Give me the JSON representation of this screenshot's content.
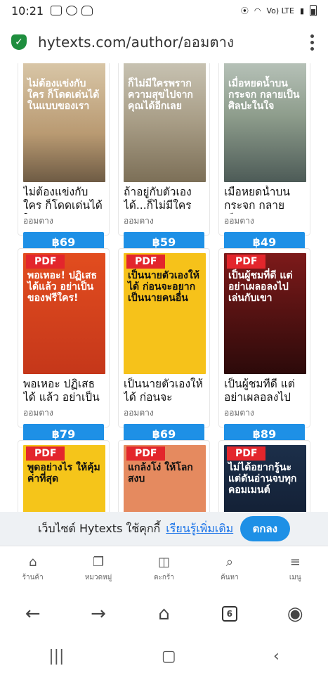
{
  "status": {
    "time": "10:21",
    "net": "Vo) LTE"
  },
  "browser": {
    "url": "hytexts.com/author/ออมตาง"
  },
  "products": [
    {
      "cover_text": "ไม่ต้องแข่งกับใคร ก็โดดเด่นได้ในแบบของเรา",
      "title": "ไม่ต้องแข่งกับใคร ก็โดดเด่นได้ใน...",
      "author": "ออมตาง",
      "price": "฿69",
      "color_class": "c1",
      "badge": ""
    },
    {
      "cover_text": "ก็ไม่มีใครพรากความสุขไปจากคุณได้อีกเลย",
      "title": "ถ้าอยู่กับตัวเอง ได้...ก็ไม่มีใครพรา...",
      "author": "ออมตาง",
      "price": "฿59",
      "color_class": "c2",
      "badge": ""
    },
    {
      "cover_text": "เมื่อหยดน้ำบนกระจก กลายเป็นศิลปะในใจ",
      "title": "เมื่อหยดน้ำบน กระจก กลายเป็น...",
      "author": "ออมตาง",
      "price": "฿49",
      "color_class": "c3",
      "badge": ""
    },
    {
      "cover_text": "พอเหอะ! ปฏิเสธได้แล้ว อย่าเป็นของฟรีใคร!",
      "title": "พอเหอะ ปฏิเสธได้ แล้ว อย่าเป็นขอ...",
      "author": "ออมตาง",
      "price": "฿79",
      "color_class": "c4",
      "badge": "PDF"
    },
    {
      "cover_text": "เป็นนายตัวเองให้ได้ ก่อนจะอยากเป็นนายคนอื่น",
      "title": "เป็นนายตัวเองให้ ได้ ก่อนจะอยาก...",
      "author": "ออมตาง",
      "price": "฿69",
      "color_class": "c5",
      "badge": "PDF"
    },
    {
      "cover_text": "เป็นผู้ชมที่ดี แต่อย่าเผลอลงไปเล่นกับเขา",
      "title": "เป็นผู้ชมที่ดี แต่ อย่าเผลอลงไปเล่...",
      "author": "ออมตาง",
      "price": "฿89",
      "color_class": "c6",
      "badge": "PDF"
    },
    {
      "cover_text": "พูดอย่างไร ให้คุ้มค่าที่สุด",
      "title": "",
      "author": "",
      "price": "",
      "color_class": "c7",
      "badge": "PDF"
    },
    {
      "cover_text": "แกล้งโง่ ให้โลกสงบ",
      "title": "",
      "author": "",
      "price": "",
      "color_class": "c8",
      "badge": "PDF"
    },
    {
      "cover_text": "ไม่ได้อยากรู้นะ แต่ดันอ่านจบทุกคอมเมนต์",
      "title": "",
      "author": "",
      "price": "",
      "color_class": "c9",
      "badge": "PDF"
    }
  ],
  "cookie": {
    "text": "เว็บไซต์ Hytexts ใช้คุกกี้",
    "learn_more": "เรียนรู้เพิ่มเติม",
    "ok": "ตกลง"
  },
  "bottom_nav": [
    {
      "label": "ร้านค้า",
      "icon": "store-icon",
      "glyph": "⌂"
    },
    {
      "label": "หมวดหมู่",
      "icon": "category-icon",
      "glyph": "❐"
    },
    {
      "label": "ตะกร้า",
      "icon": "bag-icon",
      "glyph": "◫"
    },
    {
      "label": "ค้นหา",
      "icon": "search-icon",
      "glyph": "⌕"
    },
    {
      "label": "เมนู",
      "icon": "menu-icon",
      "glyph": "≡"
    }
  ],
  "browser_nav": {
    "tabs": "6"
  }
}
